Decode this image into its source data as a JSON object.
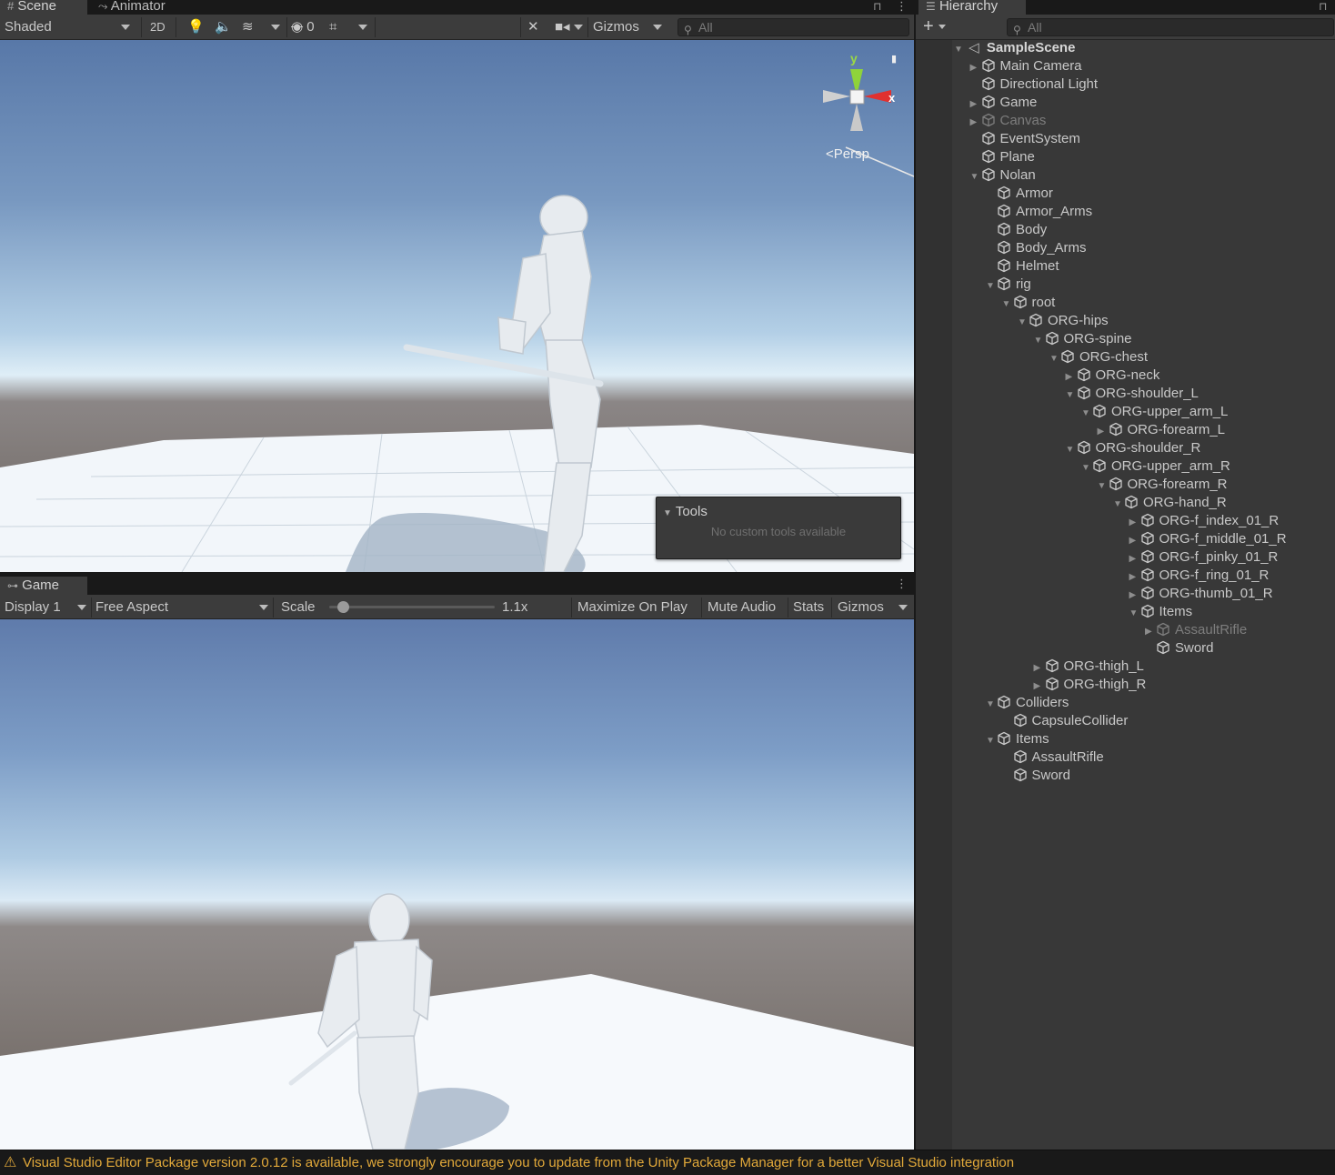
{
  "scene_panel": {
    "tabs": [
      {
        "label": "Scene",
        "icon": "grid-icon"
      },
      {
        "label": "Animator",
        "icon": "animator-icon"
      }
    ],
    "toolbar": {
      "shading_mode": "Shaded",
      "mode_2d": "2D",
      "hidden_count": "0",
      "gizmos_label": "Gizmos",
      "search_placeholder": "All"
    },
    "gizmo": {
      "y_label": "y",
      "x_label": "x",
      "projection": "Persp"
    },
    "tools_overlay": {
      "title": "Tools",
      "message": "No custom tools available"
    }
  },
  "game_panel": {
    "tab": {
      "label": "Game",
      "icon": "gamepad-icon"
    },
    "toolbar": {
      "display": "Display 1",
      "aspect": "Free Aspect",
      "scale_label": "Scale",
      "scale_value": "1.1x",
      "scale_fraction": 0.05,
      "maximize": "Maximize On Play",
      "mute": "Mute Audio",
      "stats": "Stats",
      "gizmos": "Gizmos"
    }
  },
  "hierarchy": {
    "tab_label": "Hierarchy",
    "add_label": "+",
    "search_placeholder": "All",
    "scene": "SampleScene",
    "items": [
      {
        "label": "Main Camera",
        "depth": 1,
        "expand": "collapsed",
        "dim": false
      },
      {
        "label": "Directional Light",
        "depth": 1,
        "expand": "none",
        "dim": false
      },
      {
        "label": "Game",
        "depth": 1,
        "expand": "collapsed",
        "dim": false
      },
      {
        "label": "Canvas",
        "depth": 1,
        "expand": "collapsed",
        "dim": true
      },
      {
        "label": "EventSystem",
        "depth": 1,
        "expand": "none",
        "dim": false
      },
      {
        "label": "Plane",
        "depth": 1,
        "expand": "none",
        "dim": false
      },
      {
        "label": "Nolan",
        "depth": 1,
        "expand": "expanded",
        "dim": false
      },
      {
        "label": "Armor",
        "depth": 2,
        "expand": "none",
        "dim": false
      },
      {
        "label": "Armor_Arms",
        "depth": 2,
        "expand": "none",
        "dim": false
      },
      {
        "label": "Body",
        "depth": 2,
        "expand": "none",
        "dim": false
      },
      {
        "label": "Body_Arms",
        "depth": 2,
        "expand": "none",
        "dim": false
      },
      {
        "label": "Helmet",
        "depth": 2,
        "expand": "none",
        "dim": false
      },
      {
        "label": "rig",
        "depth": 2,
        "expand": "expanded",
        "dim": false
      },
      {
        "label": "root",
        "depth": 3,
        "expand": "expanded",
        "dim": false
      },
      {
        "label": "ORG-hips",
        "depth": 4,
        "expand": "expanded",
        "dim": false
      },
      {
        "label": "ORG-spine",
        "depth": 5,
        "expand": "expanded",
        "dim": false
      },
      {
        "label": "ORG-chest",
        "depth": 6,
        "expand": "expanded",
        "dim": false
      },
      {
        "label": "ORG-neck",
        "depth": 7,
        "expand": "collapsed",
        "dim": false
      },
      {
        "label": "ORG-shoulder_L",
        "depth": 7,
        "expand": "expanded",
        "dim": false
      },
      {
        "label": "ORG-upper_arm_L",
        "depth": 8,
        "expand": "expanded",
        "dim": false
      },
      {
        "label": "ORG-forearm_L",
        "depth": 9,
        "expand": "collapsed",
        "dim": false
      },
      {
        "label": "ORG-shoulder_R",
        "depth": 7,
        "expand": "expanded",
        "dim": false
      },
      {
        "label": "ORG-upper_arm_R",
        "depth": 8,
        "expand": "expanded",
        "dim": false
      },
      {
        "label": "ORG-forearm_R",
        "depth": 9,
        "expand": "expanded",
        "dim": false
      },
      {
        "label": "ORG-hand_R",
        "depth": 10,
        "expand": "expanded",
        "dim": false
      },
      {
        "label": "ORG-f_index_01_R",
        "depth": 11,
        "expand": "collapsed",
        "dim": false
      },
      {
        "label": "ORG-f_middle_01_R",
        "depth": 11,
        "expand": "collapsed",
        "dim": false
      },
      {
        "label": "ORG-f_pinky_01_R",
        "depth": 11,
        "expand": "collapsed",
        "dim": false
      },
      {
        "label": "ORG-f_ring_01_R",
        "depth": 11,
        "expand": "collapsed",
        "dim": false
      },
      {
        "label": "ORG-thumb_01_R",
        "depth": 11,
        "expand": "collapsed",
        "dim": false
      },
      {
        "label": "Items",
        "depth": 11,
        "expand": "expanded",
        "dim": false
      },
      {
        "label": "AssaultRifle",
        "depth": 12,
        "expand": "collapsed",
        "dim": true
      },
      {
        "label": "Sword",
        "depth": 12,
        "expand": "none",
        "dim": false
      },
      {
        "label": "ORG-thigh_L",
        "depth": 5,
        "expand": "collapsed",
        "dim": false
      },
      {
        "label": "ORG-thigh_R",
        "depth": 5,
        "expand": "collapsed",
        "dim": false
      },
      {
        "label": "Colliders",
        "depth": 2,
        "expand": "expanded",
        "dim": false
      },
      {
        "label": "CapsuleCollider",
        "depth": 3,
        "expand": "none",
        "dim": false
      },
      {
        "label": "Items",
        "depth": 2,
        "expand": "expanded",
        "dim": false
      },
      {
        "label": "AssaultRifle",
        "depth": 3,
        "expand": "none",
        "dim": false
      },
      {
        "label": "Sword",
        "depth": 3,
        "expand": "none",
        "dim": false
      }
    ]
  },
  "status": {
    "message": "Visual Studio Editor Package version 2.0.12 is available, we strongly encourage you to update from the Unity Package Manager for a better Visual Studio integration",
    "icon": "warning-icon",
    "color": "#e2a93a"
  }
}
